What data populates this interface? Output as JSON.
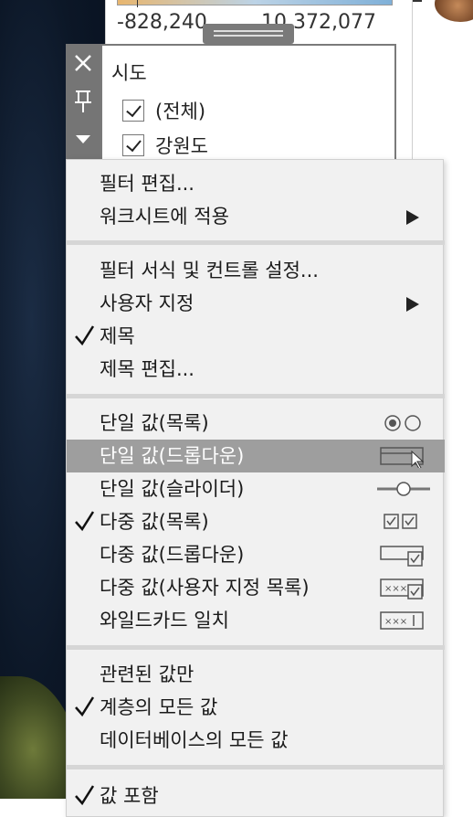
{
  "legend": {
    "min": "-828,240",
    "max": "10,372,077"
  },
  "filter": {
    "title": "시도",
    "items": [
      {
        "label": "(전체)",
        "checked": true
      },
      {
        "label": "강원도",
        "checked": true
      }
    ]
  },
  "controls": {
    "close_icon": "close-icon",
    "pin_icon": "pin-icon",
    "dropdown_icon": "chevron-down-icon"
  },
  "menu": {
    "edit_filter": "필터 편집...",
    "apply_to_worksheets": "워크시트에 적용",
    "format_filters": "필터 서식 및 컨트롤 설정...",
    "customize": "사용자 지정",
    "title": "제목",
    "edit_title": "제목 편집...",
    "single_list": "단일 값(목록)",
    "single_dropdown": "단일 값(드롭다운)",
    "single_slider": "단일 값(슬라이더)",
    "multi_list": "다중 값(목록)",
    "multi_dropdown": "다중 값(드롭다운)",
    "multi_custom": "다중 값(사용자 지정 목록)",
    "wildcard": "와일드카드 일치",
    "relevant_values": "관련된 값만",
    "all_in_hierarchy": "계층의 모든 값",
    "all_in_database": "데이터베이스의 모든 값",
    "include_values": "값 포함"
  },
  "colors": {
    "menu_bg": "#f1f1f1",
    "highlight": "#9e9e9e",
    "control_strip": "#757575"
  }
}
